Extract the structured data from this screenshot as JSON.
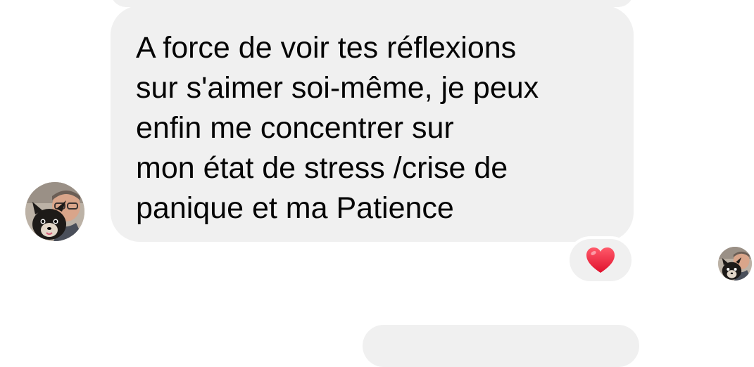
{
  "message": {
    "lines": [
      "A force de voir tes réflexions",
      "sur s'aimer soi-même, je peux",
      "enfin me concentrer sur",
      "mon état de stress /crise de",
      "panique et ma Patience"
    ]
  },
  "reaction": {
    "icon": "heart-icon",
    "color": "#f0233e"
  },
  "colors": {
    "bubble": "#f0f0f0",
    "text": "#050505",
    "background": "#ffffff"
  }
}
